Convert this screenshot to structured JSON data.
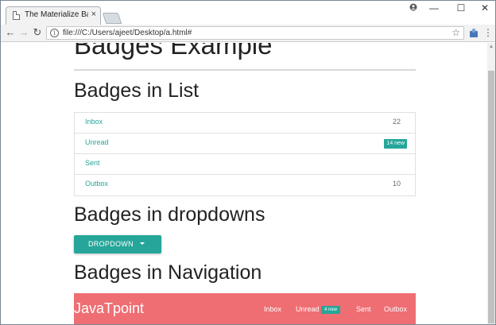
{
  "browser": {
    "tab_title": "The Materialize Badges E",
    "tab_close": "×",
    "url": "file:///C:/Users/ajeet/Desktop/a.html#",
    "star": "☆",
    "info": "i",
    "back": "←",
    "forward": "→",
    "reload": "↻",
    "menu": "⋮",
    "minimize": "—",
    "maximize": "☐",
    "close": "✕",
    "icons": [
      "document-icon",
      "profile-icon",
      "info-icon",
      "star-icon",
      "extension-icon",
      "menu-icon"
    ]
  },
  "page": {
    "main_heading": "Badges Example",
    "list_heading": "Badges in List",
    "dropdown_heading": "Badges in dropdowns",
    "nav_heading": "Badges in Navigation",
    "list_items": [
      {
        "label": "Inbox",
        "badge": "22",
        "badge_type": "number"
      },
      {
        "label": "Unread",
        "badge": "14 new",
        "badge_type": "new"
      },
      {
        "label": "Sent",
        "badge": "",
        "badge_type": "none"
      },
      {
        "label": "Outbox",
        "badge": "10",
        "badge_type": "number"
      }
    ],
    "dropdown_label": "DROPDOWN",
    "navbar": {
      "brand": "JavaTpoint",
      "links": [
        "Inbox",
        "Unread",
        "Sent",
        "Outbox"
      ],
      "unread_badge": "4 new"
    }
  },
  "colors": {
    "teal": "#26a69a",
    "navbar": "#ee6e73"
  }
}
